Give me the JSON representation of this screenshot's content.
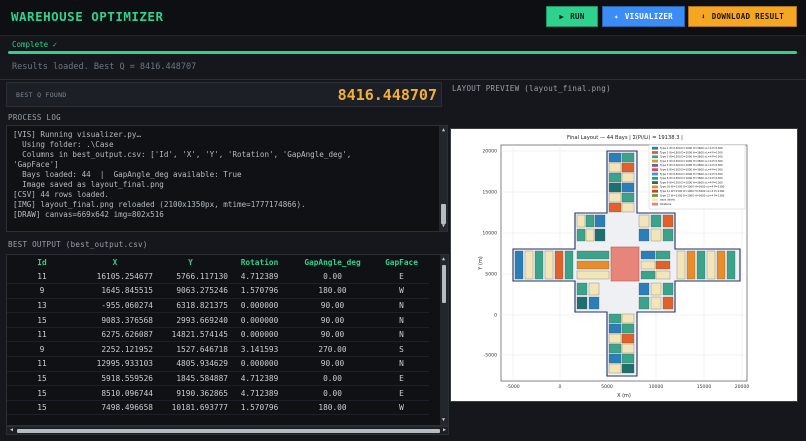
{
  "app": {
    "title": "WAREHOUSE OPTIMIZER"
  },
  "toolbar": {
    "run": {
      "icon": "play-icon",
      "glyph": "▶",
      "label": "RUN"
    },
    "visualizer": {
      "icon": "sparkle-icon",
      "glyph": "✦",
      "label": "VISUALIZER"
    },
    "download": {
      "icon": "download-icon",
      "glyph": "⬇",
      "label": "DOWNLOAD RESULT"
    }
  },
  "status": {
    "text": "Complete ✓",
    "progress": 1.0
  },
  "results_message": "Results loaded.  Best Q = 8416.448707",
  "best_q": {
    "label": "BEST Q FOUND",
    "value": "8416.448707"
  },
  "process_log": {
    "title": "PROCESS LOG",
    "lines": [
      "[VIS] Running visualizer.py…",
      "  Using folder: .\\Case",
      "  Columns in best_output.csv: ['Id', 'X', 'Y', 'Rotation', 'GapAngle_deg',",
      "'GapFace']",
      "  Bays loaded: 44  |  GapAngle_deg available: True",
      "  Image saved as layout_final.png",
      "[CSV] 44 rows loaded.",
      "[IMG] layout_final.png reloaded (2100x1350px, mtime=1777174866).",
      "[DRAW] canvas=669x642 img=802x516"
    ]
  },
  "best_output": {
    "title": "BEST OUTPUT  (best_output.csv)",
    "columns": [
      "Id",
      "X",
      "Y",
      "Rotation",
      "GapAngle_deg",
      "GapFace"
    ],
    "rows": [
      [
        "11",
        "16105.254677",
        "5766.117130",
        "4.712389",
        "0.00",
        "E"
      ],
      [
        "9",
        "1645.845515",
        "9063.275246",
        "1.570796",
        "180.00",
        "W"
      ],
      [
        "13",
        "-955.060274",
        "6318.821375",
        "0.000000",
        "90.00",
        "N"
      ],
      [
        "15",
        "9083.376568",
        "2993.669240",
        "0.000000",
        "90.00",
        "N"
      ],
      [
        "11",
        "6275.626087",
        "14821.574145",
        "0.000000",
        "90.00",
        "N"
      ],
      [
        "9",
        "2252.121952",
        "1527.646718",
        "3.141593",
        "270.00",
        "S"
      ],
      [
        "11",
        "12995.933103",
        "4805.934629",
        "0.000000",
        "90.00",
        "N"
      ],
      [
        "15",
        "5918.559526",
        "1845.584887",
        "4.712389",
        "0.00",
        "E"
      ],
      [
        "15",
        "8510.096744",
        "9190.362865",
        "4.712389",
        "0.00",
        "E"
      ],
      [
        "15",
        "7498.496658",
        "10181.693777",
        "1.570796",
        "180.00",
        "W"
      ]
    ]
  },
  "layout_preview": {
    "title": "LAYOUT PREVIEW  (layout_final.png)",
    "plot_title": "Final Layout — 44 Bays  |  Σ(Pi/Li) = 19138.3  |",
    "xlabel": "X (m)",
    "ylabel": "Y (m)",
    "xticks": [
      "-5000",
      "0",
      "5000",
      "10000",
      "15000",
      "20000"
    ],
    "yticks": [
      "20000",
      "15000",
      "10000",
      "5000",
      "0",
      "-5000"
    ],
    "legend": [
      {
        "label": "Type 1  W=1300 D=1000 H=3600  nL=4  P=1300",
        "color": "#2a7fb8"
      },
      {
        "label": "Type 2  W=1300 D=1000 H=3600  nL=4  P=1300",
        "color": "#e0622a"
      },
      {
        "label": "Type 3  W=1300 D=1000 H=3600  nL=4  P=1300",
        "color": "#3aa38a"
      },
      {
        "label": "Type 4  W=1300 D=1000 H=3600  nL=4  P=1300",
        "color": "#c9a227"
      },
      {
        "label": "Type 5  W=1300 D=1000 H=3600  nL=4  P=1300",
        "color": "#7a5aa8"
      },
      {
        "label": "Type 6  W=1300 D=1000 H=3600  nL=4  P=1300",
        "color": "#d94d4d"
      },
      {
        "label": "Type 7  W=1300 D=1000 H=3600  nL=4  P=1300",
        "color": "#4d8fd9"
      },
      {
        "label": "Type 8  W=1300 D=1000 H=3600  nL=4  P=1300",
        "color": "#2f9e5e"
      },
      {
        "label": "Type 9  W=1300 D=1000 H=3600  nL=4  P=1300",
        "color": "#1f6f6f"
      },
      {
        "label": "Type 10  W=1300 D=1000 H=3600  nL=4  P=1300",
        "color": "#e88d2a"
      },
      {
        "label": "Type 11  W=1300 D=1000 H=3600  nL=4  P=1300",
        "color": "#b8473a"
      },
      {
        "label": "Type 12  W=1300 D=1000 H=3600  nL=4  P=1300",
        "color": "#6b9e3a"
      },
      {
        "label": "bays (aisle)",
        "color": "#f2e6b8"
      },
      {
        "label": "Obstacle",
        "color": "#e8857a"
      }
    ]
  }
}
